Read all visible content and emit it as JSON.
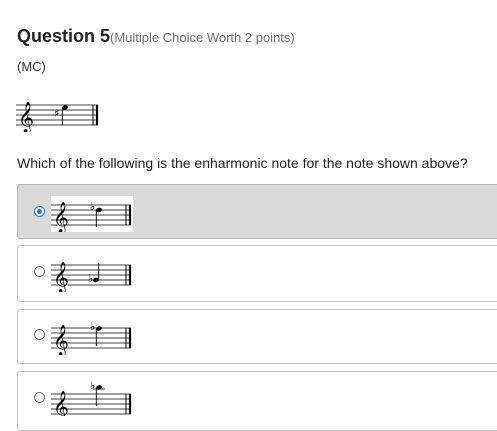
{
  "question": {
    "title": "Question 5",
    "points": "(Multiple Choice Worth 2 points)",
    "type": "(MC)",
    "prompt": "Which of the following is the enharmonic note for the note shown above?"
  },
  "stimulus": {
    "clef": "treble",
    "accidental": "sharp",
    "note_value": "quarter"
  },
  "options": [
    {
      "selected": true,
      "accidental": "flat",
      "note_value": "quarter"
    },
    {
      "selected": false,
      "accidental": "flat",
      "note_value": "quarter"
    },
    {
      "selected": false,
      "accidental": "flat",
      "note_value": "quarter"
    },
    {
      "selected": false,
      "accidental": "flat",
      "note_value": "quarter"
    }
  ],
  "colors": {
    "accent": "#1a73e8",
    "selected_bg": "#d9d9d9",
    "border": "#c4c4c4"
  }
}
